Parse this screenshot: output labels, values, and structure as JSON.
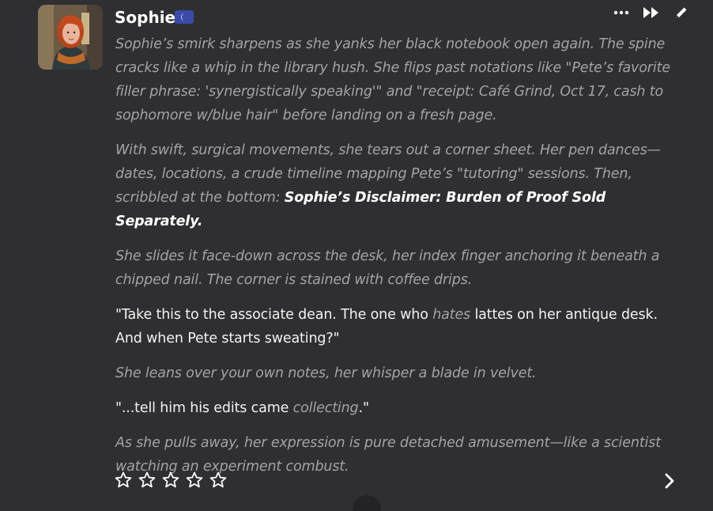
{
  "message": {
    "author": "Sophie",
    "badge_icon": "moon-icon",
    "avatar_icon": "character-portrait",
    "actions": [
      "more-icon",
      "fast-forward-icon",
      "edit-icon"
    ],
    "paragraphs": {
      "p1": "Sophie’s smirk sharpens as she yanks her black notebook open again. The spine cracks like a whip in the library hush. She flips past notations like \"Pete’s favorite filler phrase: 'synergistically speaking'\" and \"receipt: Café Grind, Oct 17, cash to sophomore w/blue hair\" before landing on a fresh page.",
      "p2_a": "With swift, surgical movements, she tears out a corner sheet. Her pen dances—dates, locations, a crude timeline mapping Pete’s \"tutoring\" sessions. Then, scribbled at the bottom: ",
      "p2_b": "Sophie’s Disclaimer: Burden of Proof Sold Separately.",
      "p3": "She slides it face-down across the desk, her index finger anchoring it beneath a chipped nail. The corner is stained with coffee drips.",
      "p4_a": "\"Take this to the associate dean. The one who ",
      "p4_b": "hates",
      "p4_c": " lattes on her antique desk. And when Pete starts sweating?\"",
      "p5": "She leans over your own notes, her whisper a blade in velvet.",
      "p6_a": "\"...tell him his edits came ",
      "p6_b": "collecting",
      "p6_c": ".\"",
      "p7": "As she pulls away, her expression is pure detached amusement—like a scientist watching an experiment combust."
    },
    "rating": {
      "max": 5,
      "value": 0
    },
    "colors": {
      "background": "#2f2f32",
      "narration": "#a3a3a8",
      "speech": "#f2f2f2",
      "badge": "#3b4aa8"
    }
  }
}
